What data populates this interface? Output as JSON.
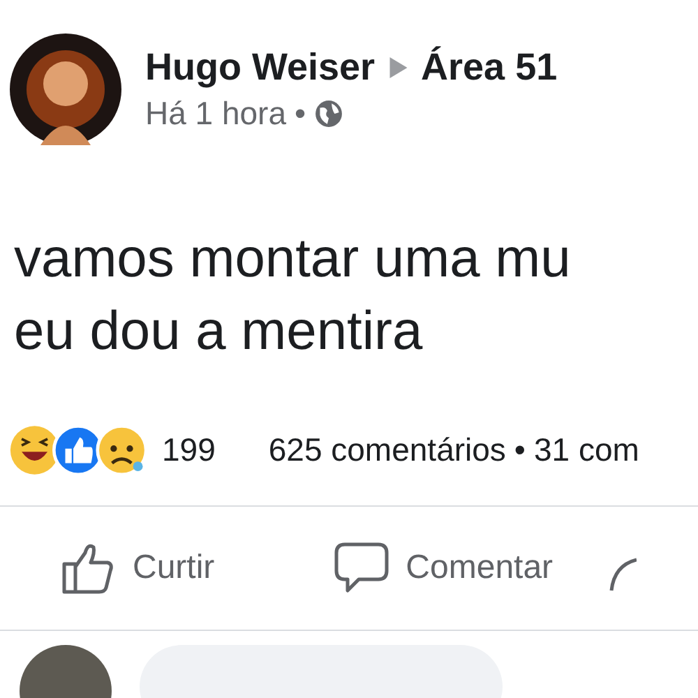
{
  "post": {
    "author": "Hugo Weiser",
    "group": "Área 51",
    "time": "Há 1 hora",
    "separator": "•",
    "text_lines": [
      "vamos montar uma mu",
      "eu dou a mentira"
    ]
  },
  "stats": {
    "reaction_count": "199",
    "comments": "625 comentários",
    "separator": "•",
    "shares": "31 com"
  },
  "actions": [
    {
      "kind": "like",
      "label": "Curtir"
    },
    {
      "kind": "comment",
      "label": "Comentar"
    },
    {
      "kind": "share"
    }
  ]
}
